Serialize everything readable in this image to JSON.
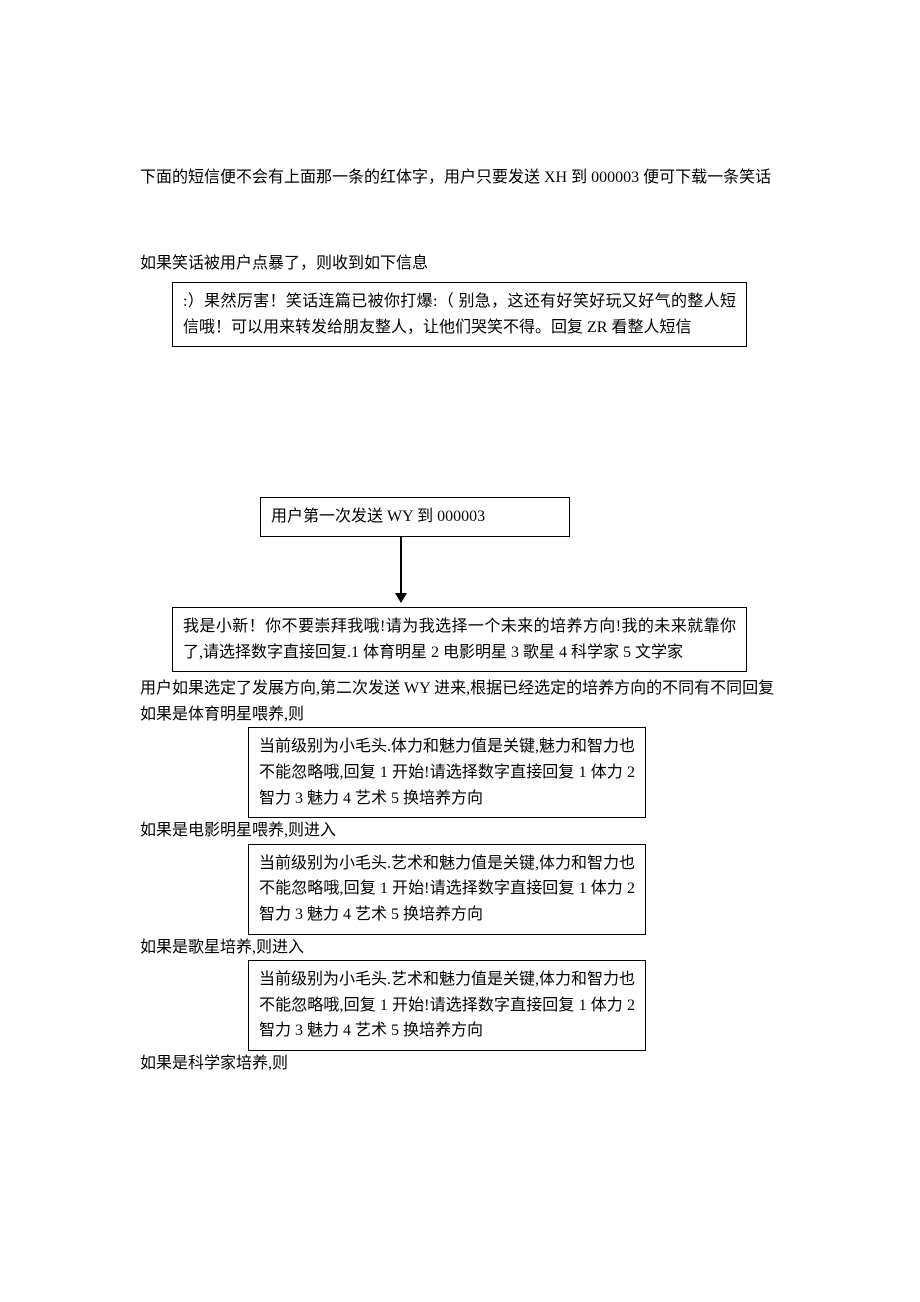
{
  "intro1": "下面的短信便不会有上面那一条的红体字，用户只要发送 XH 到 000003 便可下载一条笑话",
  "intro2": "如果笑话被用户点暴了，则收到如下信息",
  "box1": ":）果然厉害！笑话连篇已被你打爆:（ 别急，这还有好笑好玩又好气的整人短信哦！可以用来转发给朋友整人，让他们哭笑不得。回复 ZR 看整人短信",
  "box2": "用户第一次发送 WY 到 000003",
  "box3": "我是小新！你不要崇拜我哦!请为我选择一个未来的培养方向!我的未来就靠你了,请选择数字直接回复.1 体育明星 2 电影明星 3 歌星 4 科学家 5 文学家",
  "para2": "用户如果选定了发展方向,第二次发送 WY 进来,根据已经选定的培养方向的不同有不同回复",
  "line_sport": "如果是体育明星喂养,则",
  "box_sport": "当前级别为小毛头.体力和魅力值是关键,魅力和智力也不能忽略哦,回复 1 开始!请选择数字直接回复 1 体力 2 智力 3 魅力 4 艺术 5 换培养方向",
  "line_movie": "如果是电影明星喂养,则进入",
  "box_movie": "当前级别为小毛头.艺术和魅力值是关键,体力和智力也不能忽略哦,回复 1 开始!请选择数字直接回复 1 体力 2 智力 3 魅力 4 艺术 5 换培养方向",
  "line_singer": "如果是歌星培养,则进入",
  "box_singer": "当前级别为小毛头.艺术和魅力值是关键,体力和智力也不能忽略哦,回复 1 开始!请选择数字直接回复 1 体力 2 智力 3 魅力 4 艺术 5 换培养方向",
  "line_scientist": "如果是科学家培养,则"
}
